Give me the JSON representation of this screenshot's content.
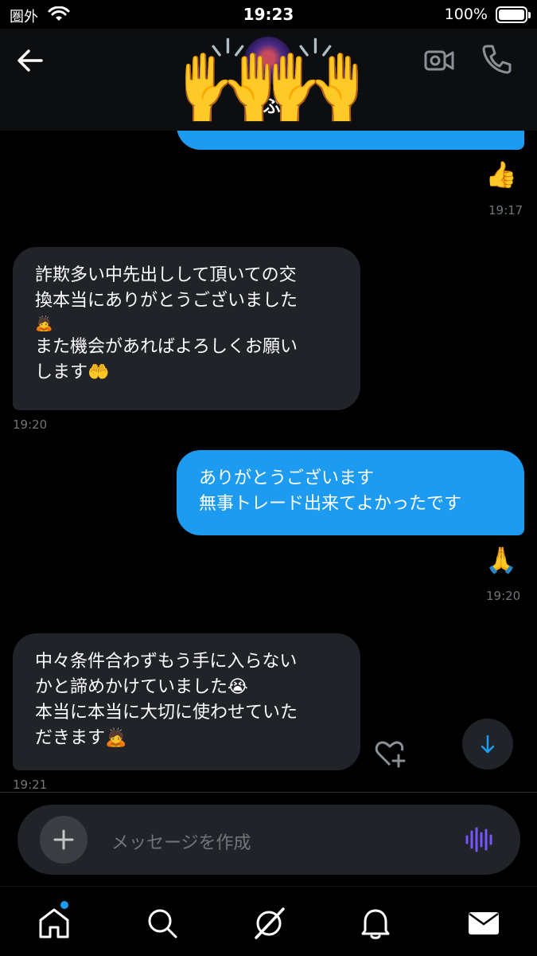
{
  "status_bar": {
    "carrier": "圏外",
    "time": "19:23",
    "battery": "100%"
  },
  "header": {
    "name": "ぶ",
    "back_icon": "arrow-left-icon",
    "video_icon": "video-camera-icon",
    "phone_icon": "phone-icon",
    "overlay_emoji_left": "🙌",
    "overlay_emoji_right": "🙌"
  },
  "messages": [
    {
      "direction": "sent",
      "lines": [
        "ありがとうございます",
        "無事トレード出来てよかったです"
      ],
      "reaction": "🙏",
      "time": "19:20"
    },
    {
      "direction": "received",
      "lines": [
        "中々条件合わずもう手に入らない",
        "かと諦めかけていました😭",
        "本当に本当に大切に使わせていた",
        "だきます🙇"
      ],
      "time": "19:21"
    }
  ],
  "earlier": {
    "first_reaction": "👍",
    "first_time": "19:17",
    "received_lines": [
      "詐欺多い中先出しして頂いての交",
      "換本当にありがとうございました",
      "🙇",
      "また機会があればよろしくお願い",
      "します🤲"
    ],
    "received_time": "19:20"
  },
  "composer": {
    "placeholder": "メッセージを作成"
  },
  "tab_bar": {
    "items": [
      "home-icon",
      "search-icon",
      "grok-icon",
      "bell-icon",
      "mail-icon"
    ]
  },
  "colors": {
    "sent_bubble": "#1d9bf0",
    "received_bubble": "#202327",
    "background": "#000000",
    "muted_text": "#71767b",
    "voice_accent": "#7856ff"
  }
}
